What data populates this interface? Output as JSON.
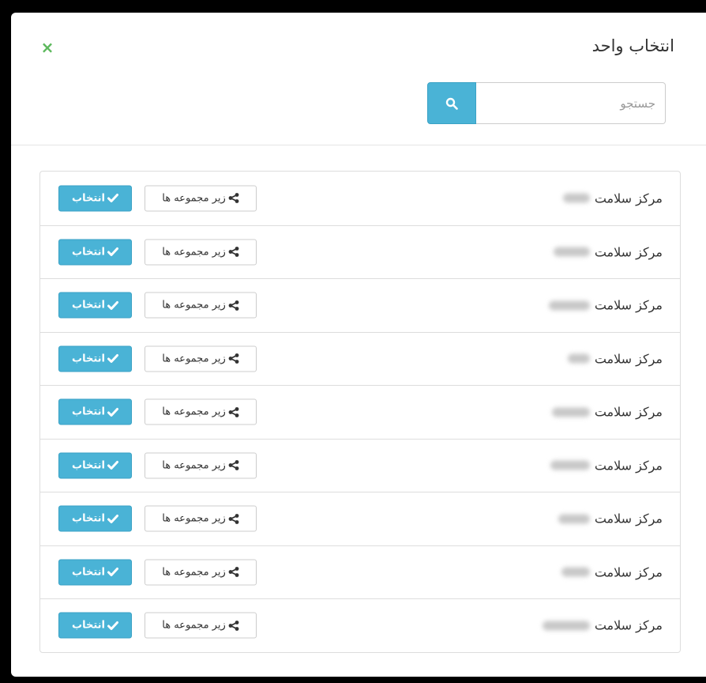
{
  "modal": {
    "title": "انتخاب واحد",
    "close_glyph": "×"
  },
  "search": {
    "placeholder": "جستجو",
    "icon": "search-icon"
  },
  "colors": {
    "accent": "#4ab3d6",
    "close": "#5cb85c"
  },
  "units": [
    {
      "prefix": "مرکز سلامت",
      "sub_label": "زیر مجموعه ها",
      "select_label": "انتخاب"
    },
    {
      "prefix": "مرکز سلامت",
      "sub_label": "زیر مجموعه ها",
      "select_label": "انتخاب"
    },
    {
      "prefix": "مرکز سلامت",
      "sub_label": "زیر مجموعه ها",
      "select_label": "انتخاب"
    },
    {
      "prefix": "مرکز سلامت",
      "sub_label": "زیر مجموعه ها",
      "select_label": "انتخاب"
    },
    {
      "prefix": "مرکز سلامت",
      "sub_label": "زیر مجموعه ها",
      "select_label": "انتخاب"
    },
    {
      "prefix": "مرکز سلامت",
      "sub_label": "زیر مجموعه ها",
      "select_label": "انتخاب"
    },
    {
      "prefix": "مرکز سلامت",
      "sub_label": "زیر مجموعه ها",
      "select_label": "انتخاب"
    },
    {
      "prefix": "مرکز سلامت",
      "sub_label": "زیر مجموعه ها",
      "select_label": "انتخاب"
    },
    {
      "prefix": "مرکز سلامت",
      "sub_label": "زیر مجموعه ها",
      "select_label": "انتخاب"
    }
  ]
}
